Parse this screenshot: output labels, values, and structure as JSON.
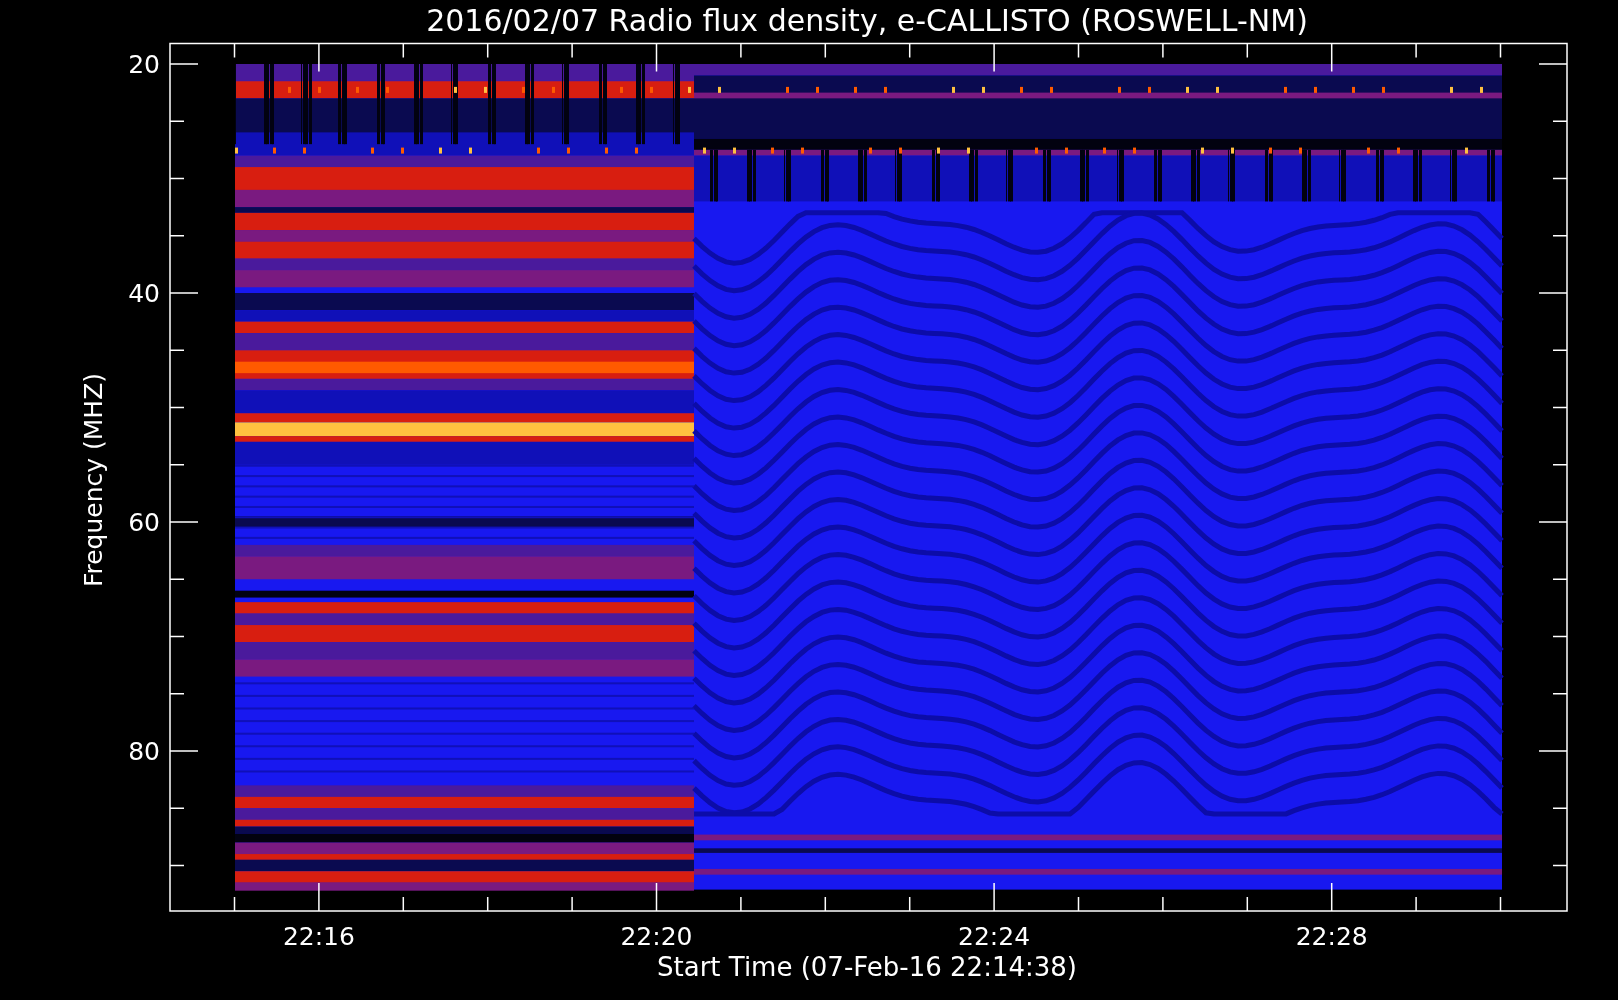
{
  "plot": {
    "title": "2016/02/07  Radio flux density, e-CALLISTO (ROSWELL-NM)",
    "ylabel": "Frequency (MHZ)",
    "xlabel": "Start Time (07-Feb-16 22:14:38)",
    "yticks": [
      "20",
      "40",
      "60",
      "80"
    ],
    "xticks": [
      "22:16",
      "22:20",
      "22:24",
      "22:28"
    ]
  }
}
